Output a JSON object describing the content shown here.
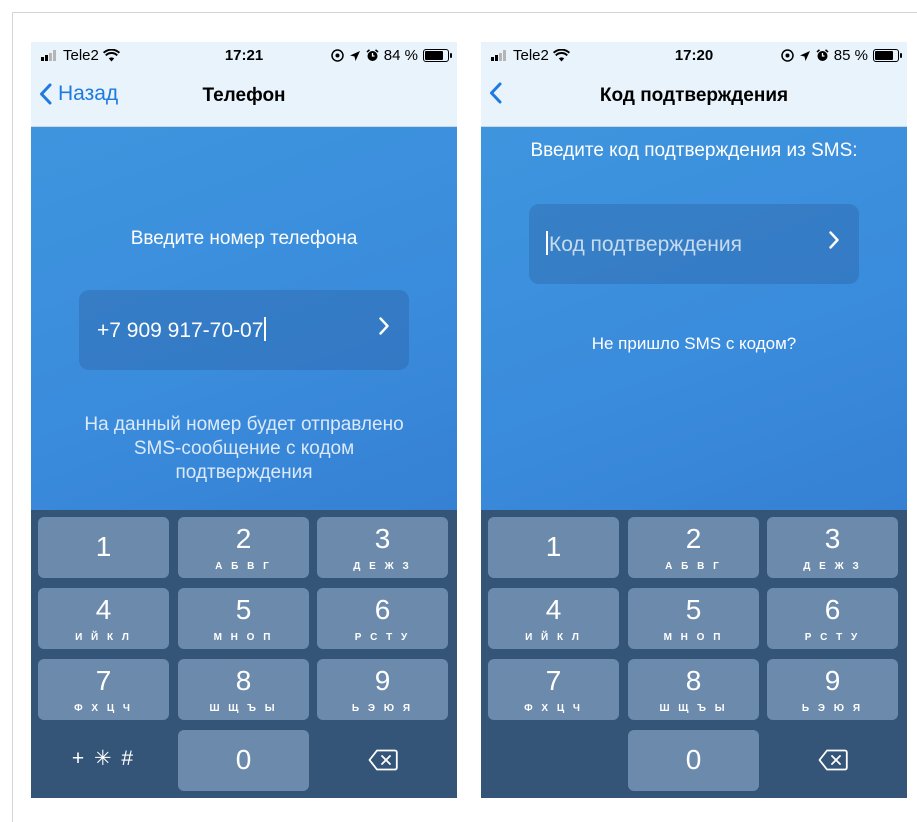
{
  "screens": [
    {
      "status": {
        "carrier": "Tele2",
        "time": "17:21",
        "battery": "84 %",
        "battery_level": 0.84
      },
      "nav": {
        "back_label": "Назад",
        "title": "Телефон"
      },
      "prompt": "Введите номер телефона",
      "input": {
        "value": "+7 909 917-70-07"
      },
      "hint_lines": [
        "На данный номер будет отправлено",
        "SMS-сообщение с кодом",
        "подтверждения"
      ]
    },
    {
      "status": {
        "carrier": "Tele2",
        "time": "17:20",
        "battery": "85 %",
        "battery_level": 0.85
      },
      "nav": {
        "back_label": "",
        "title": "Код подтверждения"
      },
      "prompt": "Введите код подтверждения из SMS:",
      "input": {
        "placeholder": "Код подтверждения"
      },
      "resend_label": "Не пришло SMS с кодом?"
    }
  ],
  "keypad": {
    "keys": [
      {
        "digit": "1",
        "letters": ""
      },
      {
        "digit": "2",
        "letters": "А Б В Г"
      },
      {
        "digit": "3",
        "letters": "Д Е Ж З"
      },
      {
        "digit": "4",
        "letters": "И Й К Л"
      },
      {
        "digit": "5",
        "letters": "М Н О П"
      },
      {
        "digit": "6",
        "letters": "Р С Т У"
      },
      {
        "digit": "7",
        "letters": "Ф Х Ц Ч"
      },
      {
        "digit": "8",
        "letters": "Ш Щ Ъ Ы"
      },
      {
        "digit": "9",
        "letters": "Ь Э Ю Я"
      },
      {
        "digit": "0",
        "letters": ""
      }
    ],
    "symbols": "+ ✳ #"
  },
  "icons": {
    "status_right": [
      "location-lock-icon",
      "location-arrow-icon",
      "alarm-icon",
      "battery-icon"
    ],
    "arrow": "chevron-right-icon",
    "delete": "backspace-icon"
  },
  "colors": {
    "accent": "#1f7ae0",
    "background": "#3a8bdc",
    "keypad": "#345577",
    "key": "#6c8bac"
  }
}
